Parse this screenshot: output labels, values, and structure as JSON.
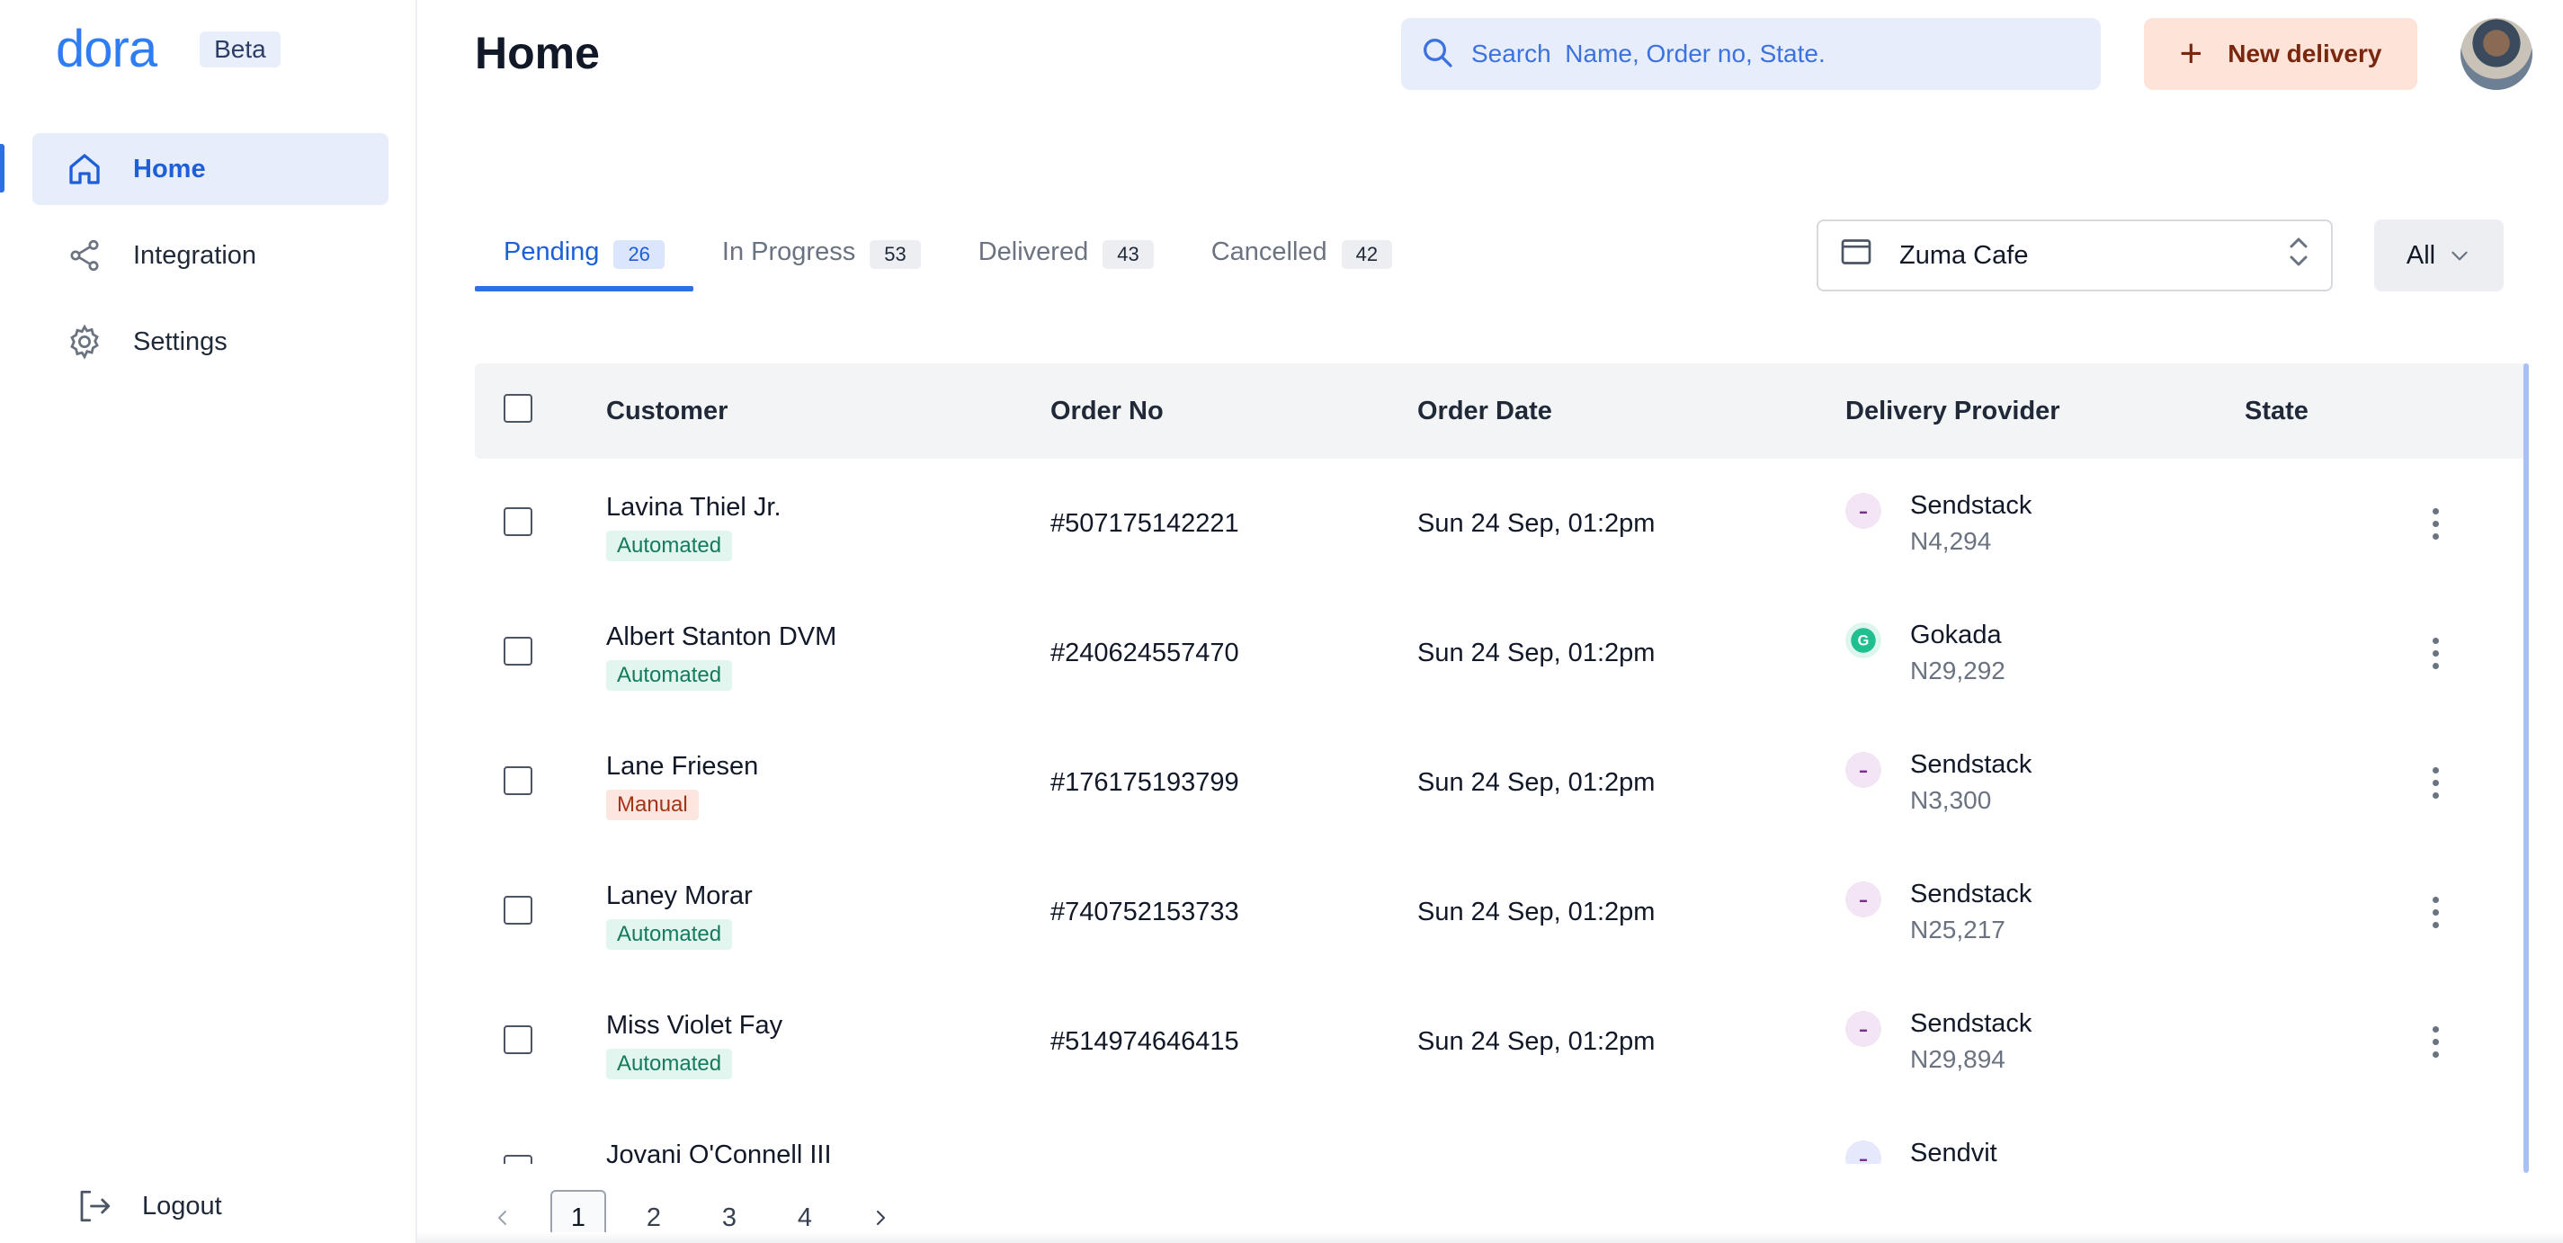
{
  "app": {
    "logo_text": "dora",
    "beta_label": "Beta",
    "page_title": "Home"
  },
  "sidebar": {
    "items": [
      {
        "label": "Home",
        "icon": "home-icon",
        "active": true
      },
      {
        "label": "Integration",
        "icon": "share-icon",
        "active": false
      },
      {
        "label": "Settings",
        "icon": "gear-icon",
        "active": false
      }
    ],
    "logout_label": "Logout"
  },
  "header": {
    "search_placeholder": "Search  Name, Order no, State.",
    "new_delivery_label": "New delivery"
  },
  "tabs": [
    {
      "label": "Pending",
      "count": "26",
      "active": true
    },
    {
      "label": "In Progress",
      "count": "53",
      "active": false
    },
    {
      "label": "Delivered",
      "count": "43",
      "active": false
    },
    {
      "label": "Cancelled",
      "count": "42",
      "active": false
    }
  ],
  "filters": {
    "store_value": "Zuma Cafe",
    "status_filter": "All"
  },
  "table": {
    "columns": [
      "Customer",
      "Order No",
      "Order Date",
      "Delivery Provider",
      "State"
    ],
    "rows": [
      {
        "customer": "Lavina Thiel Jr.",
        "tag": "Automated",
        "tag_type": "auto",
        "order_no": "#507175142221",
        "order_date": "Sun 24 Sep, 01:2pm",
        "provider": "Sendstack",
        "price": "N4,294"
      },
      {
        "customer": "Albert Stanton DVM",
        "tag": "Automated",
        "tag_type": "auto",
        "order_no": "#240624557470",
        "order_date": "Sun 24 Sep, 01:2pm",
        "provider": "Gokada",
        "price": "N29,292"
      },
      {
        "customer": "Lane Friesen",
        "tag": "Manual",
        "tag_type": "manual",
        "order_no": "#176175193799",
        "order_date": "Sun 24 Sep, 01:2pm",
        "provider": "Sendstack",
        "price": "N3,300"
      },
      {
        "customer": "Laney Morar",
        "tag": "Automated",
        "tag_type": "auto",
        "order_no": "#740752153733",
        "order_date": "Sun 24 Sep, 01:2pm",
        "provider": "Sendstack",
        "price": "N25,217"
      },
      {
        "customer": "Miss Violet Fay",
        "tag": "Automated",
        "tag_type": "auto",
        "order_no": "#514974646415",
        "order_date": "Sun 24 Sep, 01:2pm",
        "provider": "Sendstack",
        "price": "N29,894"
      },
      {
        "customer": "Jovani O'Connell III",
        "tag": "",
        "tag_type": "",
        "order_no": "",
        "order_date": "",
        "provider": "Sendvit",
        "price": ""
      }
    ]
  },
  "pagination": {
    "pages": [
      "1",
      "2",
      "3",
      "4"
    ],
    "current": "1"
  },
  "colors": {
    "accent": "#2f6fe4",
    "new_delivery_bg": "#fde3d8",
    "automated_tag": "#137a5c",
    "manual_tag": "#a33516"
  }
}
